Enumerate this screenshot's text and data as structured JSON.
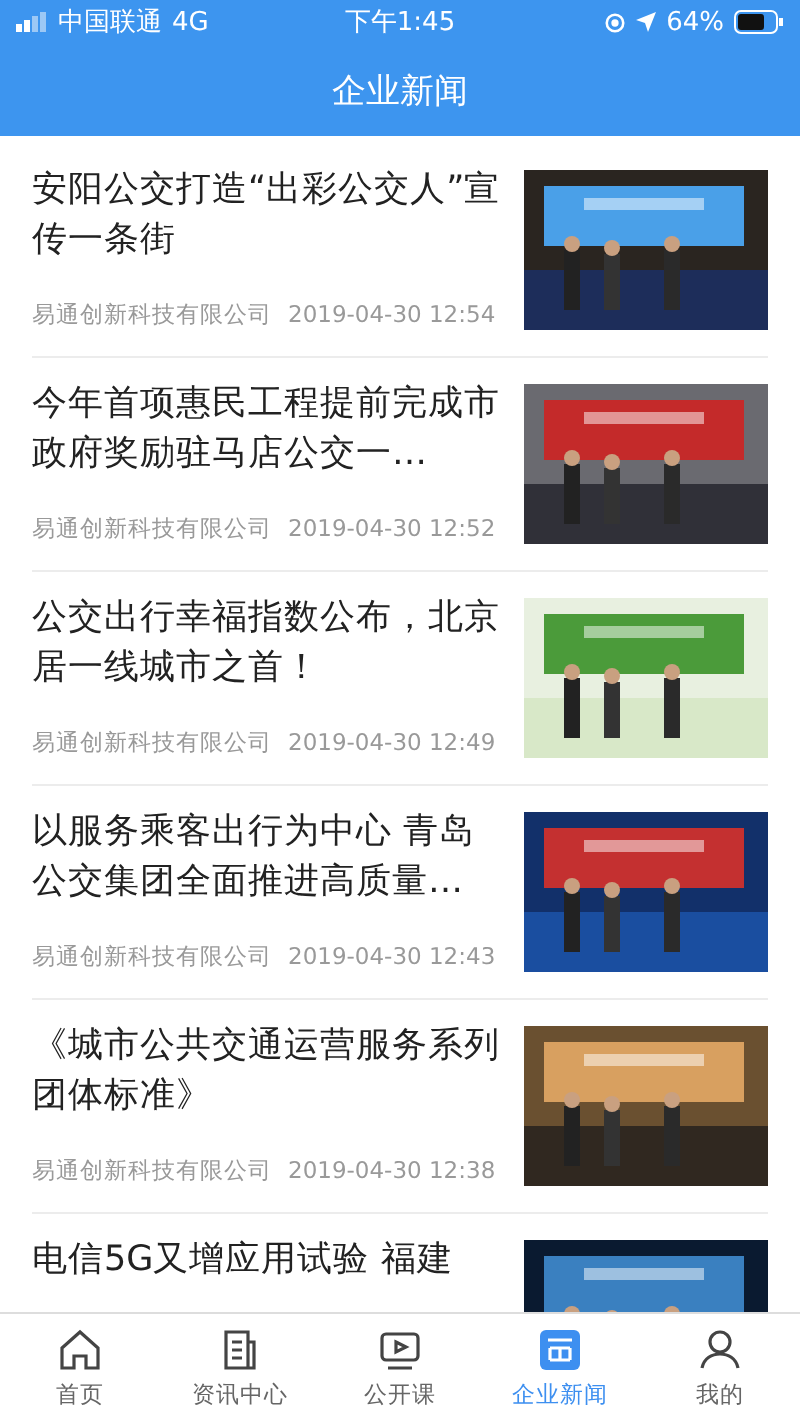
{
  "status_bar": {
    "carrier": "中国联通",
    "network": "4G",
    "time": "下午1:45",
    "battery": "64%"
  },
  "header": {
    "title": "企业新闻"
  },
  "news": [
    {
      "title": "安阳公交打造“出彩公交人”宣传一条街",
      "source": "易通创新科技有限公司",
      "time": "2019-04-30 12:54"
    },
    {
      "title": "今年首项惠民工程提前完成市政府奖励驻马店公交一…",
      "source": "易通创新科技有限公司",
      "time": "2019-04-30 12:52"
    },
    {
      "title": "公交出行幸福指数公布，北京居一线城市之首！",
      "source": "易通创新科技有限公司",
      "time": "2019-04-30 12:49"
    },
    {
      "title": "以服务乘客出行为中心 青岛公交集团全面推进高质量…",
      "source": "易通创新科技有限公司",
      "time": "2019-04-30 12:43"
    },
    {
      "title": "《城市公共交通运营服务系列团体标准》",
      "source": "易通创新科技有限公司",
      "time": "2019-04-30 12:38"
    },
    {
      "title": "电信5G又增应用试验 福建"
    }
  ],
  "tabs": [
    {
      "label": "首页",
      "kind": "home",
      "selected": false
    },
    {
      "label": "资讯中心",
      "kind": "news",
      "selected": false
    },
    {
      "label": "公开课",
      "kind": "video",
      "selected": false
    },
    {
      "label": "企业新闻",
      "kind": "company",
      "selected": true
    },
    {
      "label": "我的",
      "kind": "user",
      "selected": false
    }
  ]
}
